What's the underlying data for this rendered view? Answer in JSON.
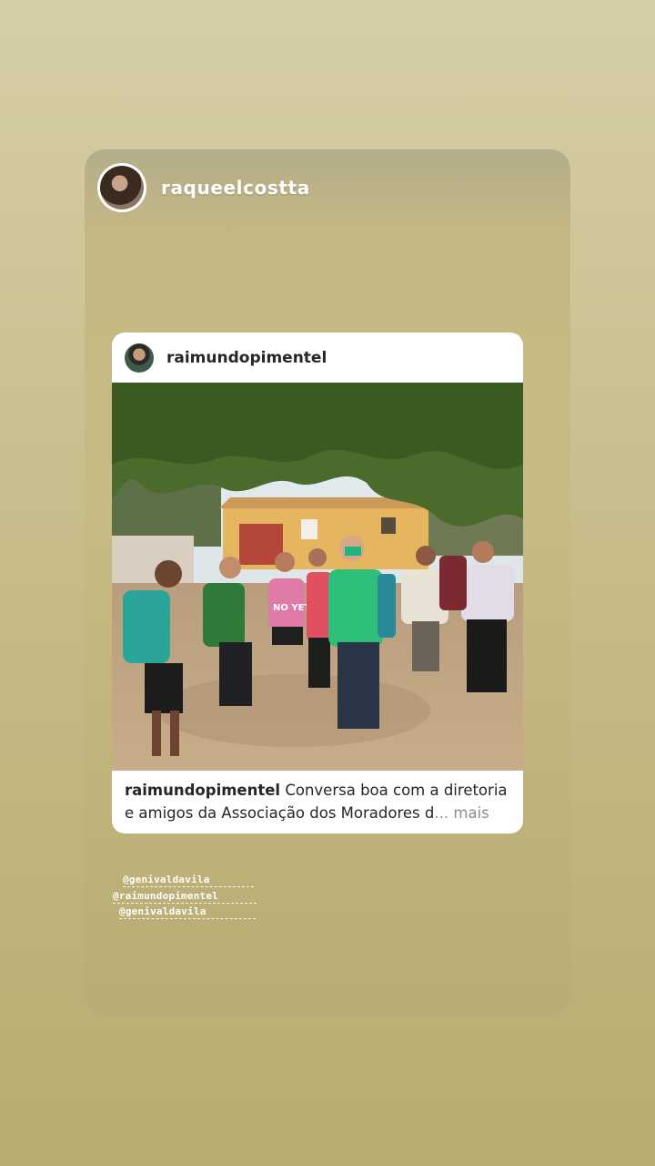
{
  "story": {
    "username": "raqueelcostta",
    "avatar_icon": "profile-photo"
  },
  "shared_post": {
    "username": "raimundopimentel",
    "avatar_icon": "profile-photo",
    "caption_user": "raimundopimentel",
    "caption_text": "Conversa boa com a diretoria e amigos da Associação dos Moradores d",
    "caption_ellipsis": "...",
    "caption_more": "mais"
  },
  "mentions": [
    "@genivaldavila",
    "@raimundopimentel",
    "@genivaldavila"
  ],
  "photo_shirt_text": "NO YET"
}
